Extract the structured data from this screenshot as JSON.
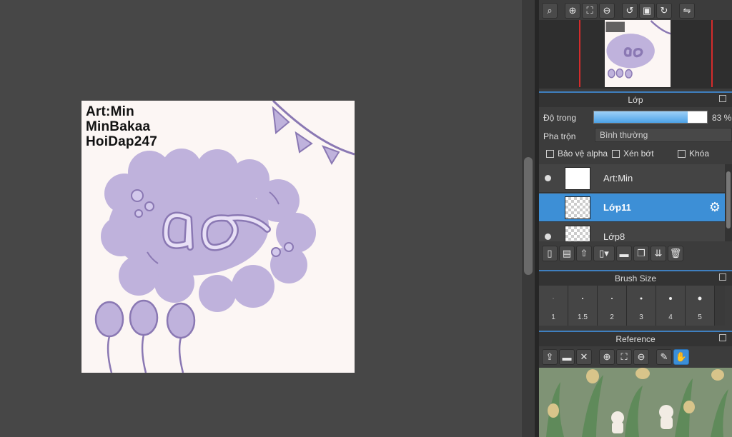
{
  "artwork": {
    "text_lines": [
      "Art:Min",
      "MinBakaa",
      "HoiDap247"
    ]
  },
  "navigator_toolbar": {
    "icons": [
      "zoom-fit-icon",
      "zoom-in-icon",
      "fit-window-icon",
      "zoom-out-icon",
      "rotate-left-icon",
      "fullscreen-icon",
      "rotate-right-icon",
      "flip-icon"
    ]
  },
  "layer_panel": {
    "title": "Lớp",
    "opacity_label": "Độ trong",
    "opacity_value": "83 %",
    "opacity_fraction": 0.83,
    "blend_label": "Pha trộn",
    "blend_value": "Bình thường",
    "checkboxes": [
      {
        "label": "Bảo vệ alpha",
        "checked": false
      },
      {
        "label": "Xén bớt",
        "checked": false
      },
      {
        "label": "Khóa",
        "checked": false
      }
    ],
    "layers": [
      {
        "name": "Art:Min",
        "visible": true,
        "selected": false
      },
      {
        "name": "Lớp11",
        "visible": false,
        "selected": true
      },
      {
        "name": "Lớp8",
        "visible": true,
        "selected": false
      }
    ]
  },
  "brush_panel": {
    "title": "Brush Size",
    "sizes": [
      "1",
      "1.5",
      "2",
      "3",
      "4",
      "5"
    ]
  },
  "reference_panel": {
    "title": "Reference"
  },
  "colors": {
    "accent": "#3d8fd6",
    "art_purple": "#bfb2dc",
    "art_outline": "#8a78b3",
    "canvas_bg": "#fcf6f4"
  }
}
